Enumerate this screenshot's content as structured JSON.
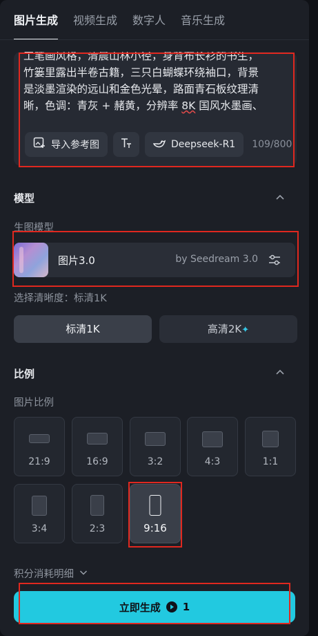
{
  "tabs": [
    {
      "label": "图片生成",
      "active": true
    },
    {
      "label": "视频生成",
      "active": false
    },
    {
      "label": "数字人",
      "active": false
    },
    {
      "label": "音乐生成",
      "active": false
    }
  ],
  "prompt": {
    "line_cut": "工笔画风格，清晨山林小径，身背布长衫的书生，",
    "line_2": "竹篓里露出半卷古籍，三只白蝴蝶环绕袖口，背景",
    "line_3": "是淡墨渲染的远山和金色光晕，路面青石板纹理清",
    "line_4_a": "晰，色调：青灰 + 赭黄，分辨率 ",
    "line_4_err": "8K",
    "line_4_b": " 国风水墨画、",
    "tools": {
      "reference_label": "导入参考图",
      "model_label": "Deepseek-R1"
    },
    "char_count": "109/800"
  },
  "model_section": {
    "title": "模型",
    "sub_label": "生图模型",
    "model_name": "图片3.0",
    "model_by": "by Seedream 3.0"
  },
  "quality": {
    "label": "选择清晰度：标清1K",
    "standard": "标清1K",
    "hd": "高清2K",
    "selected": "标清1K"
  },
  "ratio_section": {
    "title": "比例",
    "sub_label": "图片比例",
    "options": [
      "21:9",
      "16:9",
      "3:2",
      "4:3",
      "1:1",
      "3:4",
      "2:3",
      "9:16"
    ],
    "selected": "9:16"
  },
  "cost_label": "积分消耗明细",
  "generate": {
    "label": "立即生成",
    "cost": "1"
  },
  "colors": {
    "accent": "#22c9e0",
    "highlight_frame": "#e0281f",
    "panel": "#1c1f26"
  }
}
